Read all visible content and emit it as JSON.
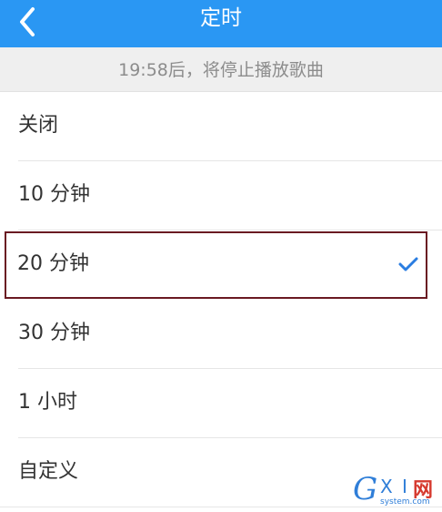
{
  "header": {
    "title": "定时",
    "accent_color": "#2a97f3",
    "back_icon": "chevron-left-icon"
  },
  "status": {
    "text": "19:58后，将停止播放歌曲"
  },
  "options": [
    {
      "label": "关闭",
      "selected": false
    },
    {
      "label": "10 分钟",
      "selected": false
    },
    {
      "label": "20 分钟",
      "selected": true
    },
    {
      "label": "30 分钟",
      "selected": false
    },
    {
      "label": "1 小时",
      "selected": false
    },
    {
      "label": "自定义",
      "selected": false
    }
  ],
  "selection": {
    "icon": "checkmark-icon",
    "color": "#2a7de1"
  },
  "watermark": {
    "g": "G",
    "xi": "X I",
    "cn": "网",
    "domain": "system.com"
  }
}
